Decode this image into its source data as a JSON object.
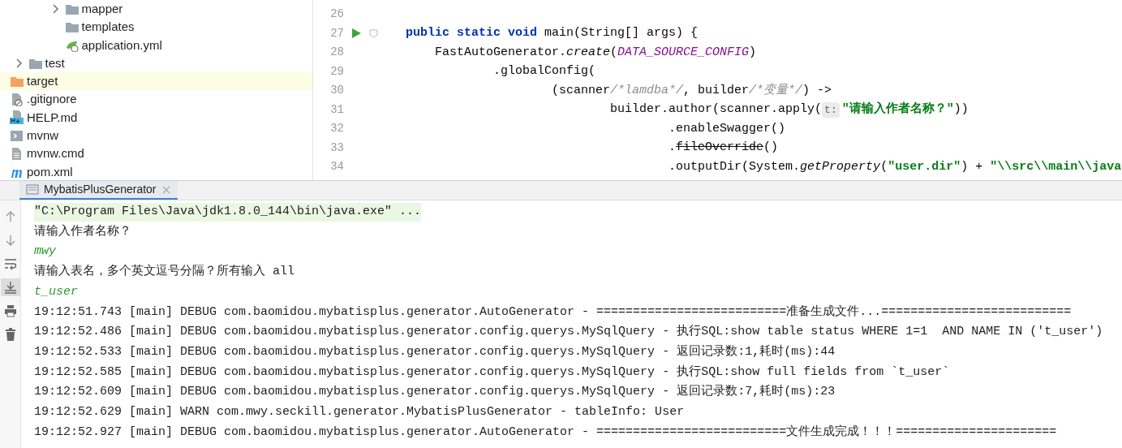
{
  "project_tree": {
    "items": [
      {
        "children": [
          {
            "children": [
              {
                "children": [
                  {
                    "name": "mapper",
                    "kind": "folder",
                    "expanded": false,
                    "selected": false
                  },
                  {
                    "name": "templates",
                    "kind": "folder",
                    "selected": false
                  },
                  {
                    "name": "application.yml",
                    "kind": "yml",
                    "selected": false
                  }
                ]
              }
            ]
          },
          {
            "name": "test",
            "kind": "folder",
            "expanded": false,
            "selected": false
          }
        ]
      },
      {
        "name": "target",
        "kind": "excluded-folder",
        "selected": true
      },
      {
        "name": ".gitignore",
        "kind": "ignore",
        "selected": false
      },
      {
        "name": "HELP.md",
        "kind": "markdown",
        "selected": false
      },
      {
        "name": "mvnw",
        "kind": "script",
        "selected": false
      },
      {
        "name": "mvnw.cmd",
        "kind": "text",
        "selected": false
      },
      {
        "name": "pom.xml",
        "kind": "maven",
        "selected": false
      }
    ]
  },
  "editor": {
    "lines": [
      {
        "number": "26"
      },
      {
        "number": "27",
        "run": true,
        "fold": true,
        "segments": [
          {
            "kind": "keyword",
            "text": "    public static void"
          },
          {
            "kind": "plain",
            "text": " main(String[] args) {"
          }
        ]
      },
      {
        "number": "28",
        "segments": [
          {
            "kind": "plain",
            "text": "        FastAutoGenerator."
          },
          {
            "kind": "static",
            "text": "create"
          },
          {
            "kind": "plain",
            "text": "("
          },
          {
            "kind": "constant",
            "text": "DATA_SOURCE_CONFIG"
          },
          {
            "kind": "plain",
            "text": ")"
          }
        ]
      },
      {
        "number": "29",
        "segments": [
          {
            "kind": "plain",
            "text": "                .globalConfig("
          }
        ]
      },
      {
        "number": "30",
        "segments": [
          {
            "kind": "plain",
            "text": "                        (scanner"
          },
          {
            "kind": "comment",
            "text": "/*lamdba*/"
          },
          {
            "kind": "plain",
            "text": ", builder"
          },
          {
            "kind": "comment",
            "text": "/*变量*/"
          },
          {
            "kind": "plain",
            "text": ") ->"
          }
        ]
      },
      {
        "number": "31",
        "segments": [
          {
            "kind": "plain",
            "text": "                                builder.author(scanner.apply("
          },
          {
            "kind": "hint",
            "text": "t:"
          },
          {
            "kind": "string",
            "text": "\"请输入作者名称？\""
          },
          {
            "kind": "plain",
            "text": "))"
          }
        ]
      },
      {
        "number": "32",
        "segments": [
          {
            "kind": "plain",
            "text": "                                        .enableSwagger()"
          }
        ]
      },
      {
        "number": "33",
        "segments": [
          {
            "kind": "plain",
            "text": "                                        ."
          },
          {
            "kind": "deprecated",
            "text": "fileOverride"
          },
          {
            "kind": "plain",
            "text": "()"
          }
        ]
      },
      {
        "number": "34",
        "segments": [
          {
            "kind": "plain",
            "text": "                                        .outputDir(System."
          },
          {
            "kind": "static",
            "text": "getProperty"
          },
          {
            "kind": "plain",
            "text": "("
          },
          {
            "kind": "string",
            "text": "\"user.dir\""
          },
          {
            "kind": "plain",
            "text": ") + "
          },
          {
            "kind": "string",
            "text": "\"\\\\src\\\\main\\\\java"
          }
        ]
      }
    ]
  },
  "run_panel": {
    "tabs": [
      {
        "label": "MybatisPlusGenerator",
        "selected": true
      }
    ],
    "toolbar": [
      {
        "kind": "up",
        "on": false
      },
      {
        "kind": "down",
        "on": false
      },
      {
        "kind": "wrap",
        "on": false
      },
      {
        "kind": "scroll-end",
        "on": true
      },
      {
        "kind": "print",
        "on": false
      },
      {
        "kind": "trash",
        "on": false
      }
    ],
    "lines": [
      {
        "kind": "command",
        "text": "\"C:\\Program Files\\Java\\jdk1.8.0_144\\bin\\java.exe\" ..."
      },
      {
        "kind": "output",
        "text": "请输入作者名称？"
      },
      {
        "kind": "input",
        "text": "mwy"
      },
      {
        "kind": "output",
        "text": "请输入表名，多个英文逗号分隔？所有输入 all"
      },
      {
        "kind": "input",
        "text": "t_user"
      },
      {
        "kind": "output",
        "text": "19:12:51.743 [main] DEBUG com.baomidou.mybatisplus.generator.AutoGenerator - ==========================准备生成文件...=========================="
      },
      {
        "kind": "output",
        "text": "19:12:52.486 [main] DEBUG com.baomidou.mybatisplus.generator.config.querys.MySqlQuery - 执行SQL:show table status WHERE 1=1  AND NAME IN ('t_user')"
      },
      {
        "kind": "output",
        "text": "19:12:52.533 [main] DEBUG com.baomidou.mybatisplus.generator.config.querys.MySqlQuery - 返回记录数:1,耗时(ms):44"
      },
      {
        "kind": "output",
        "text": "19:12:52.585 [main] DEBUG com.baomidou.mybatisplus.generator.config.querys.MySqlQuery - 执行SQL:show full fields from `t_user`"
      },
      {
        "kind": "output",
        "text": "19:12:52.609 [main] DEBUG com.baomidou.mybatisplus.generator.config.querys.MySqlQuery - 返回记录数:7,耗时(ms):23"
      },
      {
        "kind": "output",
        "text": "19:12:52.629 [main] WARN com.mwy.seckill.generator.MybatisPlusGenerator - tableInfo: User"
      },
      {
        "kind": "output",
        "text": "19:12:52.927 [main] DEBUG com.baomidou.mybatisplus.generator.AutoGenerator - ==========================文件生成完成！！！======================"
      }
    ]
  }
}
